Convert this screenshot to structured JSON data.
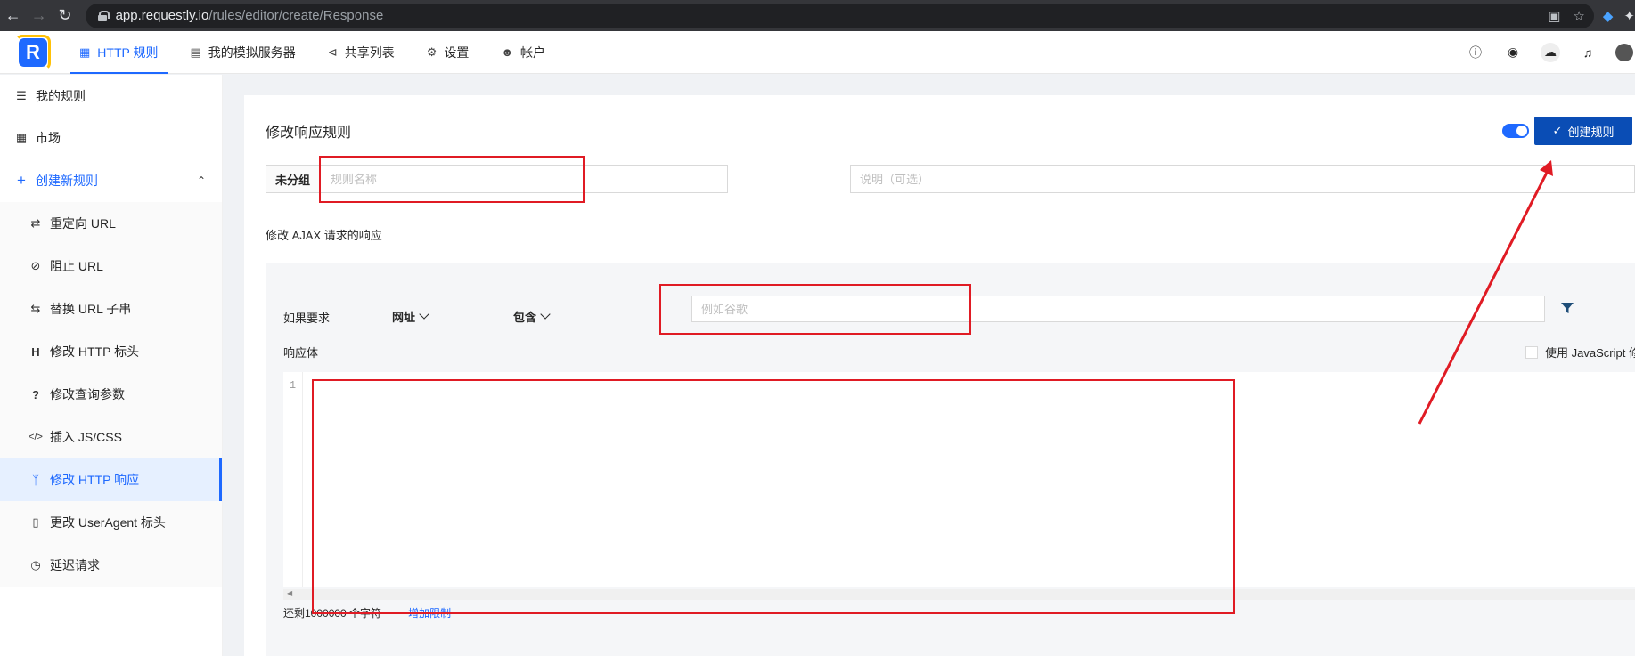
{
  "browser": {
    "url_host": "app.requestly.io",
    "url_path": "/rules/editor/create/Response"
  },
  "header": {
    "nav": [
      {
        "label": "HTTP 规则",
        "icon": "rules-icon",
        "active": true
      },
      {
        "label": "我的模拟服务器",
        "icon": "server-icon",
        "active": false
      },
      {
        "label": "共享列表",
        "icon": "share-icon",
        "active": false
      },
      {
        "label": "设置",
        "icon": "gear-icon",
        "active": false
      },
      {
        "label": "帐户",
        "icon": "user-icon",
        "active": false
      }
    ]
  },
  "sidebar": {
    "my_rules": "我的规则",
    "market": "市场",
    "create_rule": "创建新规则",
    "items": [
      {
        "label": "重定向 URL",
        "icon": "shuffle-icon"
      },
      {
        "label": "阻止 URL",
        "icon": "block-icon"
      },
      {
        "label": "替换 URL 子串",
        "icon": "swap-icon"
      },
      {
        "label": "修改 HTTP 标头",
        "icon": "heading-icon"
      },
      {
        "label": "修改查询参数",
        "icon": "question-icon"
      },
      {
        "label": "插入 JS/CSS",
        "icon": "code-icon"
      },
      {
        "label": "修改 HTTP 响应",
        "icon": "branch-icon",
        "active": true
      },
      {
        "label": "更改 UserAgent 标头",
        "icon": "mobile-icon"
      },
      {
        "label": "延迟请求",
        "icon": "clock-icon"
      }
    ]
  },
  "editor": {
    "title": "修改响应规则",
    "create_button": "创建规则",
    "group_label": "未分组",
    "name_placeholder": "规则名称",
    "desc_placeholder": "说明（可选）",
    "section_label": "修改 AJAX 请求的响应",
    "if_label": "如果要求",
    "operand": "网址",
    "operator": "包含",
    "url_placeholder": "例如谷歌",
    "body_label": "响应体",
    "js_checkbox": "使用 JavaScript 修改",
    "line_number": "1",
    "chars_left": "还剩1000000 个字符",
    "increase_limit": "增加限制"
  },
  "colors": {
    "accent": "#1e69ff",
    "button": "#0a4db5",
    "annotation": "#e01b24"
  }
}
